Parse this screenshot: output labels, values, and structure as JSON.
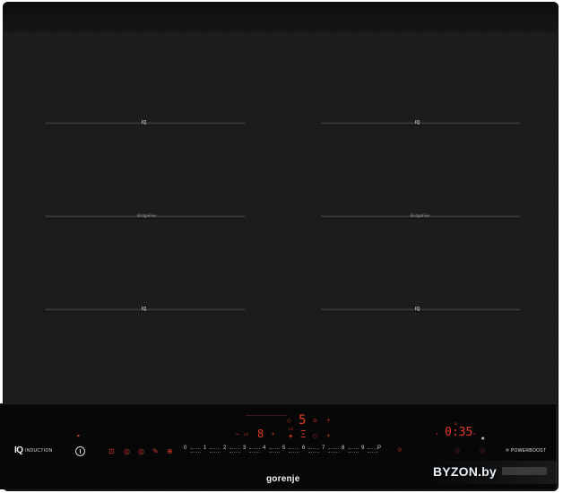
{
  "brand": {
    "iq_mark": "IQ",
    "induction_label": "INDUCTION",
    "logo": "gorenje",
    "powerboost_label": "POWERBOOST",
    "powerboost_arrows": "»"
  },
  "zones": {
    "iq_label": "IQ",
    "bridge_label": "BridgeFlex"
  },
  "display": {
    "power_level": "5",
    "zone_indicator": "8",
    "timer": "0:35"
  },
  "slider": {
    "levels": [
      "0",
      "1",
      "2",
      "3",
      "4",
      "5",
      "6",
      "7",
      "8",
      "9"
    ],
    "pause_label": "P"
  },
  "watermark": {
    "text": "BYZON.by"
  },
  "colors": {
    "glass": "#1a1a1a",
    "panel": "#070707",
    "display_red": "#e53b2b",
    "text_white": "#f1f1f1"
  },
  "icons": [
    "power-icon",
    "lock-icon",
    "timer-icon",
    "stopwatch-icon",
    "keep-warm-icon",
    "bridge-icon",
    "plus-icon",
    "minus-icon",
    "boost-icon"
  ]
}
